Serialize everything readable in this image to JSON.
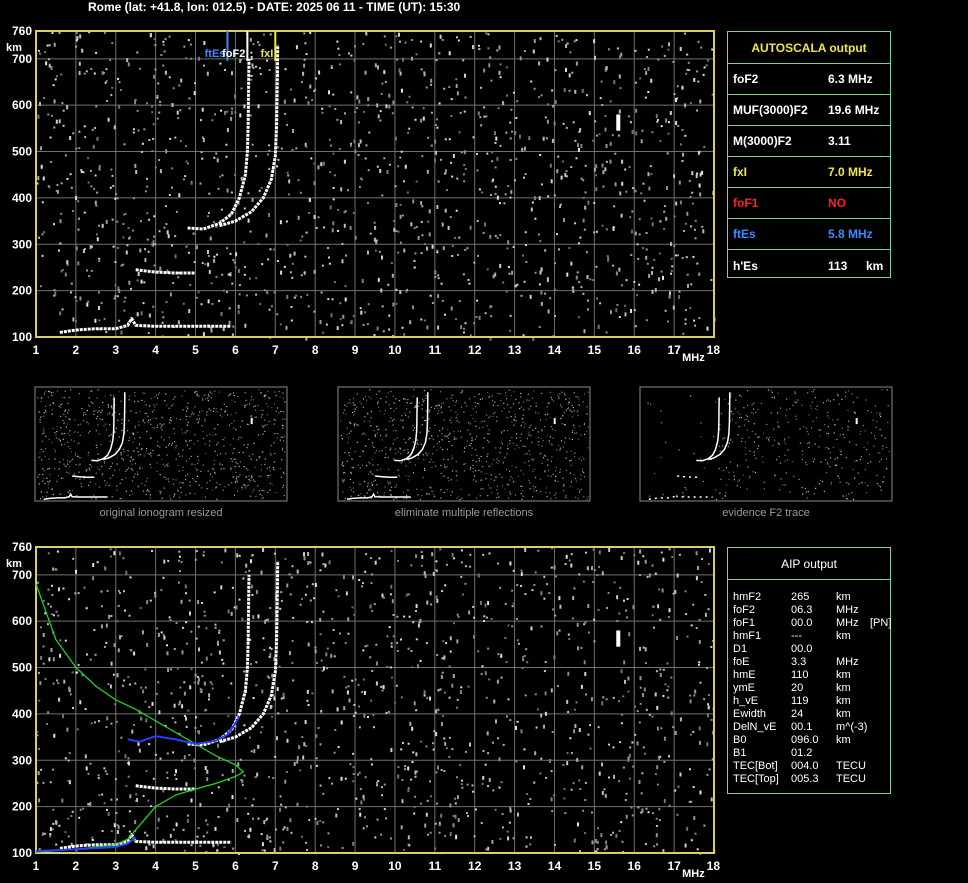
{
  "header": "Rome (lat: +41.8, lon: 012.5) - DATE: 2025 06 11 - TIME (UT): 15:30",
  "colors": {
    "axis": "#d8d060",
    "grid": "#707070",
    "panel_border": "#7fd38a",
    "yellow": "#f0e840",
    "red": "#ff2020",
    "blue": "#3a8cff",
    "green": "#22dd22",
    "trace_blue": "#2a3cff"
  },
  "autoscala": {
    "title": "AUTOSCALA output",
    "rows": [
      {
        "label": "foF2",
        "value": "6.3 MHz",
        "unit": "",
        "color": "#ffffff"
      },
      {
        "label": "MUF(3000)F2",
        "value": "19.6 MHz",
        "unit": "",
        "color": "#ffffff"
      },
      {
        "label": "M(3000)F2",
        "value": "3.11",
        "unit": "",
        "color": "#ffffff"
      },
      {
        "label": "fxI",
        "value": "7.0 MHz",
        "unit": "",
        "color": "#f0e840"
      },
      {
        "label": "foF1",
        "value": "NO",
        "unit": "",
        "color": "#ff2020"
      },
      {
        "label": "ftEs",
        "value": "5.8 MHz",
        "unit": "",
        "color": "#3a8cff"
      },
      {
        "label": "h'Es",
        "value": "113",
        "unit": "km",
        "color": "#ffffff"
      }
    ]
  },
  "aip": {
    "title": "AIP output",
    "rows": [
      {
        "label": "hmF2",
        "value": "265",
        "unit": "km",
        "extra": ""
      },
      {
        "label": "foF2",
        "value": "06.3",
        "unit": "MHz",
        "extra": ""
      },
      {
        "label": "foF1",
        "value": "00.0",
        "unit": "MHz",
        "extra": "[PN]"
      },
      {
        "label": "hmF1",
        "value": "---",
        "unit": "km",
        "extra": ""
      },
      {
        "label": "D1",
        "value": "00.0",
        "unit": "",
        "extra": ""
      },
      {
        "label": "foE",
        "value": "3.3",
        "unit": "MHz",
        "extra": ""
      },
      {
        "label": "hmE",
        "value": "110",
        "unit": "km",
        "extra": ""
      },
      {
        "label": "ymE",
        "value": "20",
        "unit": "km",
        "extra": ""
      },
      {
        "label": "h_vE",
        "value": "119",
        "unit": "km",
        "extra": ""
      },
      {
        "label": "Ewidth",
        "value": "24",
        "unit": "km",
        "extra": ""
      },
      {
        "label": "DelN_vE",
        "value": "00.1",
        "unit": "m^(-3)",
        "extra": ""
      },
      {
        "label": "B0",
        "value": "096.0",
        "unit": "km",
        "extra": ""
      },
      {
        "label": "B1",
        "value": "01.2",
        "unit": "",
        "extra": ""
      },
      {
        "label": "TEC[Bot]",
        "value": "004.0",
        "unit": "TECU",
        "extra": ""
      },
      {
        "label": "TEC[Top]",
        "value": "005.3",
        "unit": "TECU",
        "extra": ""
      }
    ]
  },
  "thumbnails": [
    {
      "caption": "original ionogram resized"
    },
    {
      "caption": "eliminate multiple reflections"
    },
    {
      "caption": "evidence F2 trace"
    }
  ],
  "chart_data": [
    {
      "type": "scatter",
      "title": "",
      "xlabel": "MHz",
      "ylabel": "km",
      "xlim": [
        1,
        18
      ],
      "ylim": [
        100,
        760
      ],
      "x_ticks": [
        1,
        2,
        3,
        4,
        5,
        6,
        7,
        8,
        9,
        10,
        11,
        12,
        13,
        14,
        15,
        16,
        17,
        18
      ],
      "y_ticks": [
        100,
        200,
        300,
        400,
        500,
        600,
        700,
        760
      ],
      "grid": true,
      "markers": [
        {
          "label": "ftEs",
          "x": 5.8,
          "color": "#3a8cff"
        },
        {
          "label": "foF2",
          "x": 6.3,
          "color": "#ffffff"
        },
        {
          "label": "fxI",
          "x": 7.0,
          "color": "#f0e840"
        }
      ],
      "traces": [
        {
          "name": "",
          "kind": "echo",
          "points": [
            [
              1.6,
              110
            ],
            [
              2.0,
              115
            ],
            [
              2.5,
              118
            ],
            [
              3.0,
              118
            ],
            [
              3.3,
              125
            ],
            [
              3.4,
              140
            ],
            [
              3.5,
              125
            ],
            [
              4.0,
              123
            ],
            [
              5.0,
              123
            ],
            [
              5.9,
              123
            ]
          ]
        },
        {
          "name": "",
          "kind": "echo",
          "points": [
            [
              3.5,
              245
            ],
            [
              4.0,
              240
            ],
            [
              4.5,
              238
            ],
            [
              5.0,
              238
            ]
          ]
        },
        {
          "name": "",
          "kind": "echo",
          "points": [
            [
              4.8,
              335
            ],
            [
              5.2,
              333
            ],
            [
              5.6,
              345
            ],
            [
              5.9,
              365
            ],
            [
              6.1,
              400
            ],
            [
              6.25,
              450
            ],
            [
              6.3,
              500
            ],
            [
              6.32,
              560
            ],
            [
              6.33,
              640
            ],
            [
              6.34,
              700
            ]
          ]
        },
        {
          "name": "",
          "kind": "echo",
          "points": [
            [
              5.6,
              340
            ],
            [
              6.0,
              350
            ],
            [
              6.4,
              370
            ],
            [
              6.7,
              400
            ],
            [
              6.9,
              440
            ],
            [
              7.0,
              490
            ],
            [
              7.03,
              550
            ],
            [
              7.05,
              650
            ],
            [
              7.06,
              730
            ]
          ]
        }
      ]
    },
    {
      "type": "scatter",
      "title": "",
      "xlabel": "MHz",
      "ylabel": "km",
      "xlim": [
        1,
        18
      ],
      "ylim": [
        100,
        760
      ],
      "x_ticks": [
        1,
        2,
        3,
        4,
        5,
        6,
        7,
        8,
        9,
        10,
        11,
        12,
        13,
        14,
        15,
        16,
        17,
        18
      ],
      "y_ticks": [
        100,
        200,
        300,
        400,
        500,
        600,
        700,
        760
      ],
      "grid": true,
      "series": [
        {
          "name": "",
          "kind": "green",
          "points": [
            [
              1.0,
              680
            ],
            [
              1.5,
              560
            ],
            [
              2.0,
              500
            ],
            [
              2.5,
              460
            ],
            [
              3.0,
              430
            ],
            [
              3.5,
              410
            ],
            [
              4.0,
              385
            ],
            [
              4.5,
              360
            ],
            [
              5.0,
              335
            ],
            [
              5.5,
              310
            ],
            [
              6.0,
              290
            ],
            [
              6.2,
              275
            ],
            [
              6.0,
              265
            ],
            [
              5.5,
              250
            ],
            [
              5.0,
              238
            ],
            [
              4.5,
              225
            ],
            [
              4.0,
              200
            ],
            [
              3.6,
              160
            ],
            [
              3.3,
              130
            ],
            [
              3.0,
              118
            ],
            [
              2.0,
              108
            ],
            [
              1.0,
              102
            ]
          ]
        },
        {
          "name": "",
          "kind": "blue",
          "points": [
            [
              1.0,
              104
            ],
            [
              2.0,
              108
            ],
            [
              3.0,
              113
            ],
            [
              3.3,
              120
            ],
            [
              3.5,
              133
            ]
          ]
        },
        {
          "name": "",
          "kind": "blue",
          "points": [
            [
              3.3,
              345
            ],
            [
              3.6,
              340
            ],
            [
              4.0,
              352
            ],
            [
              4.5,
              345
            ],
            [
              5.0,
              335
            ],
            [
              5.5,
              342
            ],
            [
              5.8,
              355
            ],
            [
              6.0,
              380
            ],
            [
              6.1,
              395
            ]
          ]
        }
      ],
      "traces": [
        {
          "name": "",
          "kind": "echo",
          "points": [
            [
              1.6,
              110
            ],
            [
              2.0,
              115
            ],
            [
              2.5,
              118
            ],
            [
              3.0,
              118
            ],
            [
              3.3,
              125
            ],
            [
              3.4,
              140
            ],
            [
              3.5,
              125
            ],
            [
              4.0,
              123
            ],
            [
              5.0,
              123
            ],
            [
              5.9,
              123
            ]
          ]
        },
        {
          "name": "",
          "kind": "echo",
          "points": [
            [
              3.5,
              245
            ],
            [
              4.0,
              240
            ],
            [
              4.5,
              238
            ],
            [
              5.0,
              238
            ]
          ]
        },
        {
          "name": "",
          "kind": "echo",
          "points": [
            [
              4.8,
              335
            ],
            [
              5.2,
              333
            ],
            [
              5.6,
              345
            ],
            [
              5.9,
              365
            ],
            [
              6.1,
              400
            ],
            [
              6.25,
              450
            ],
            [
              6.3,
              500
            ],
            [
              6.32,
              560
            ],
            [
              6.33,
              640
            ],
            [
              6.34,
              700
            ]
          ]
        },
        {
          "name": "",
          "kind": "echo",
          "points": [
            [
              5.6,
              340
            ],
            [
              6.0,
              350
            ],
            [
              6.4,
              370
            ],
            [
              6.7,
              400
            ],
            [
              6.9,
              440
            ],
            [
              7.0,
              490
            ],
            [
              7.03,
              550
            ],
            [
              7.05,
              650
            ],
            [
              7.06,
              730
            ]
          ]
        }
      ]
    }
  ]
}
